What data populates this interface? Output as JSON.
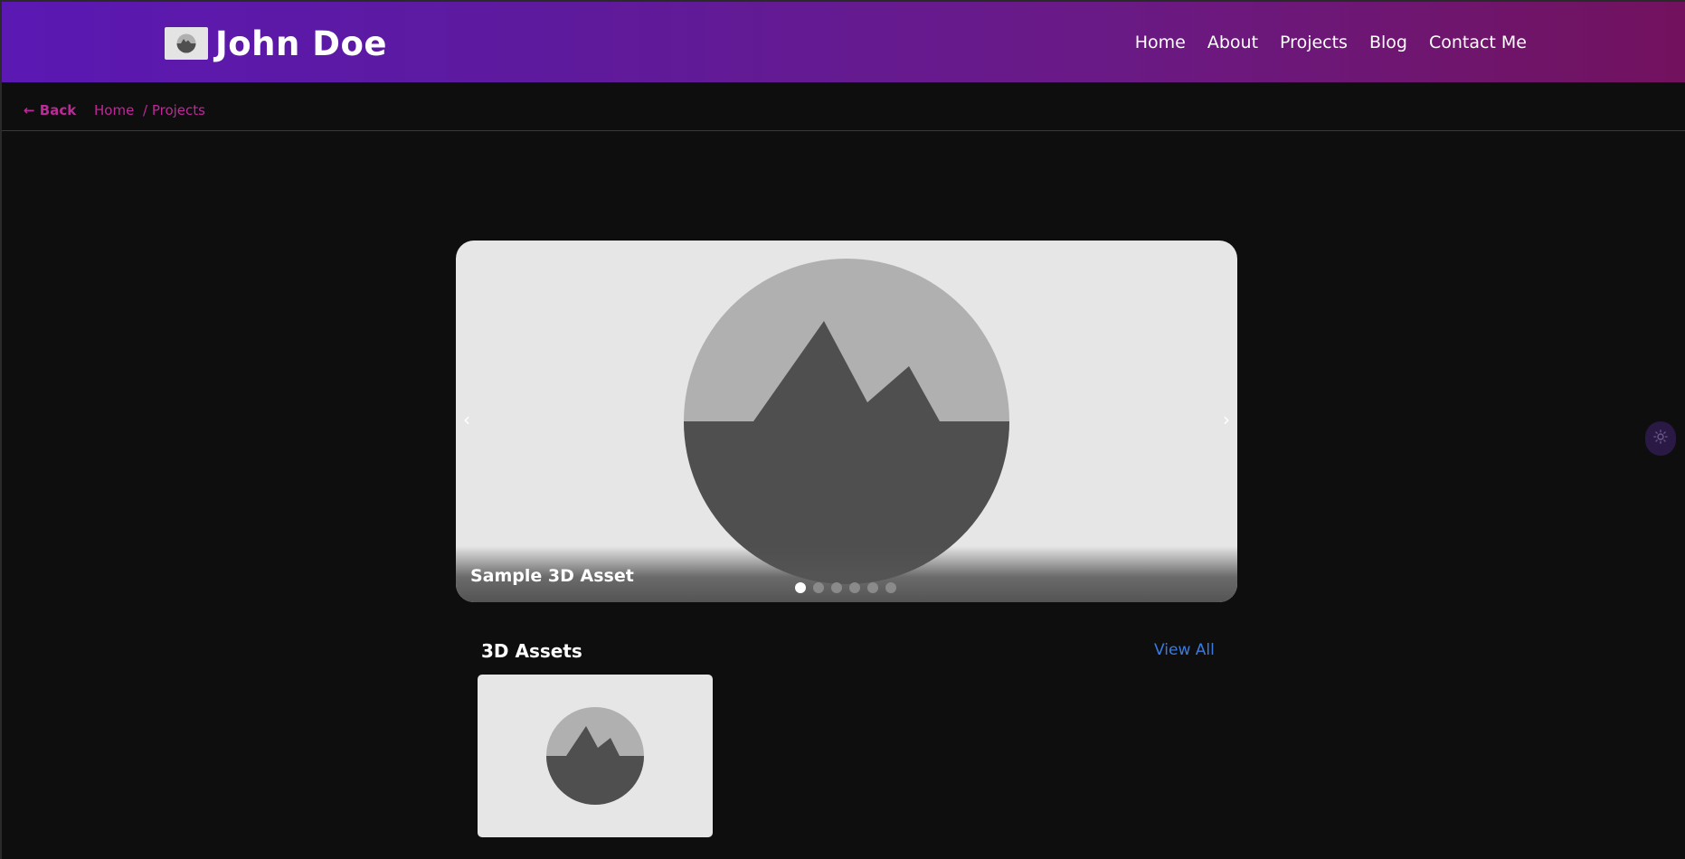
{
  "brand": {
    "name": "John Doe",
    "logo_icon": "placeholder-image-icon"
  },
  "nav": {
    "items": [
      "Home",
      "About",
      "Projects",
      "Blog",
      "Contact Me"
    ]
  },
  "subnav": {
    "back_label": "← Back",
    "breadcrumb_home": "Home",
    "breadcrumb_projects": "/ Projects"
  },
  "carousel": {
    "slide_title": "Sample 3D Asset",
    "prev_label": "‹",
    "next_label": "›",
    "slide_count": 6,
    "active_index": 0,
    "image_icon": "placeholder-image-icon"
  },
  "theme_toggle": {
    "icon": "sun-icon"
  },
  "section": {
    "title": "3D Assets",
    "view_all_label": "View All",
    "cards": [
      {
        "image_icon": "placeholder-image-icon"
      }
    ]
  },
  "colors": {
    "header_gradient_start": "#5b18b3",
    "header_gradient_end": "#72125e",
    "link_accent": "#c0279a",
    "view_all": "#3b7be0",
    "page_background": "#0e0e0e"
  }
}
